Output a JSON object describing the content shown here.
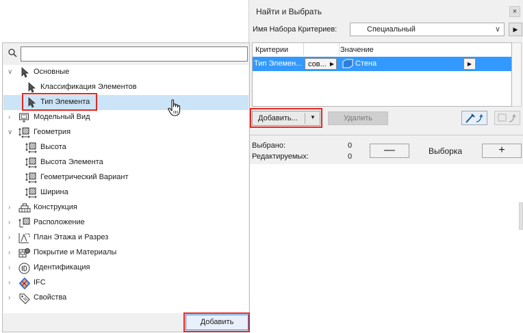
{
  "find_select": {
    "title": "Найти и Выбрать",
    "close_glyph": "×",
    "criteria_set_label": "Имя Набора Критериев:",
    "criteria_set_value": "Специальный",
    "criteria_set_chevron": "∨",
    "next_glyph": "▶",
    "table": {
      "col_criteria": "Критерии",
      "col_value": "Значение",
      "row": {
        "criterion": "Тип Элемен...",
        "condition": "сов...",
        "condition_arrow": "▶",
        "value": "Стена",
        "value_icon": "wall-icon",
        "value_arrow": "▶"
      }
    },
    "add_label": "Добавить...",
    "add_arrow": "▼",
    "remove_label": "Удалить",
    "selected_label": "Выбрано:",
    "selected_count": "0",
    "editable_label": "Редактируемых:",
    "editable_count": "0",
    "minus_glyph": "—",
    "plus_glyph": "+",
    "selection_label": "Выборка"
  },
  "tree": {
    "search_placeholder": "",
    "add_button": "Добавить",
    "items": [
      {
        "label": "Основные",
        "icon": "arrow-cursor-icon"
      },
      {
        "label": "Классификация Элементов",
        "icon": "arrow-cursor-icon"
      },
      {
        "label": "Тип Элемента",
        "icon": "arrow-cursor-icon",
        "selected": true
      },
      {
        "label": "Модельный Вид",
        "icon": "monitor-icon"
      },
      {
        "label": "Геометрия",
        "icon": "geometry-icon"
      },
      {
        "label": "Высота",
        "icon": "geometry-icon"
      },
      {
        "label": "Высота Элемента",
        "icon": "geometry-icon"
      },
      {
        "label": "Геометрический Вариант",
        "icon": "geometry-icon"
      },
      {
        "label": "Ширина",
        "icon": "geometry-icon"
      },
      {
        "label": "Конструкция",
        "icon": "structure-icon"
      },
      {
        "label": "Расположение",
        "icon": "location-icon"
      },
      {
        "label": "План Этажа и Разрез",
        "icon": "floor-plan-icon"
      },
      {
        "label": "Покрытие и Материалы",
        "icon": "materials-icon"
      },
      {
        "label": "Идентификация",
        "icon": "id-icon"
      },
      {
        "label": "IFC",
        "icon": "ifc-icon"
      },
      {
        "label": "Свойства",
        "icon": "tag-icon"
      }
    ]
  },
  "colors": {
    "accent": "#3399ff",
    "highlight": "#e52620",
    "tree_selection": "#cce4f7"
  }
}
